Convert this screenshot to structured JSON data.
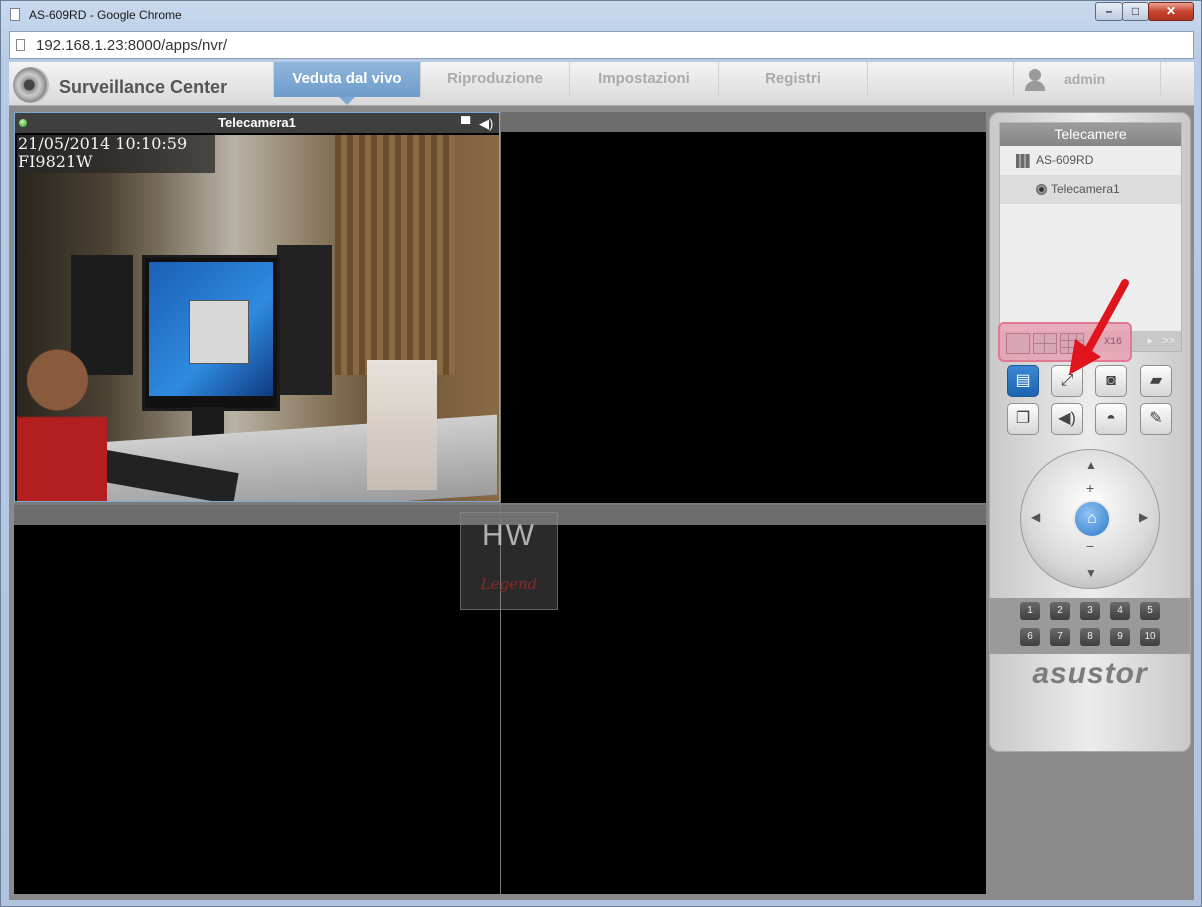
{
  "window": {
    "title": "AS-609RD - Google Chrome",
    "url": "192.168.1.23:8000/apps/nvr/"
  },
  "app": {
    "name": "Surveillance Center"
  },
  "nav": {
    "tabs": [
      {
        "label": "Veduta dal vivo",
        "active": true
      },
      {
        "label": "Riproduzione",
        "active": false
      },
      {
        "label": "Impostazioni",
        "active": false
      },
      {
        "label": "Registri",
        "active": false
      }
    ],
    "user": "admin"
  },
  "camera1": {
    "title": "Telecamera1",
    "datetime": "21/05/2014 10:10:59",
    "model": "FI9821W"
  },
  "watermark": {
    "top": "HW",
    "bottom": "Legend"
  },
  "sidebar": {
    "tree_title": "Telecamere",
    "server": "AS-609RD",
    "camera": "Telecamera1",
    "layout_x16": "X16"
  },
  "presets": [
    "1",
    "2",
    "3",
    "4",
    "5",
    "6",
    "7",
    "8",
    "9",
    "10"
  ],
  "brand": "asustor",
  "colors": {
    "accent": "#7ea8d3",
    "highlight": "#e07a93",
    "arrow": "#e0141c"
  }
}
